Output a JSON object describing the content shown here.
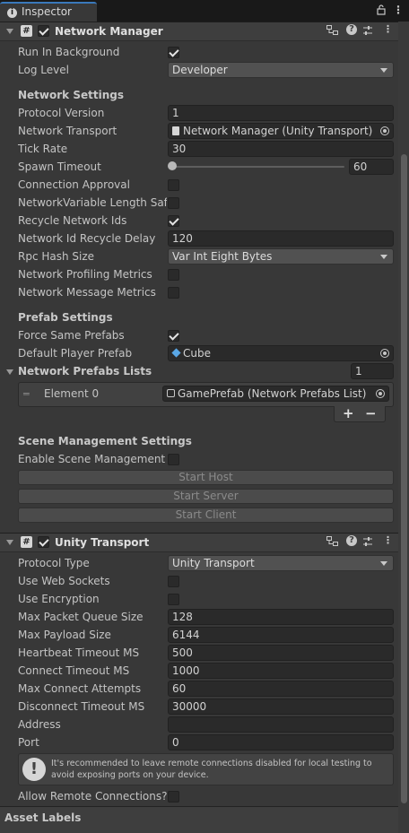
{
  "window": {
    "tab_label": "Inspector"
  },
  "network_manager": {
    "title": "Network Manager",
    "run_in_background": {
      "label": "Run In Background",
      "checked": true
    },
    "log_level": {
      "label": "Log Level",
      "value": "Developer"
    },
    "network_settings_header": "Network Settings",
    "protocol_version": {
      "label": "Protocol Version",
      "value": "1"
    },
    "network_transport": {
      "label": "Network Transport",
      "value": "Network Manager (Unity Transport)"
    },
    "tick_rate": {
      "label": "Tick Rate",
      "value": "30"
    },
    "spawn_timeout": {
      "label": "Spawn Timeout",
      "value": "60",
      "slider_fraction": 0.0
    },
    "connection_approval": {
      "label": "Connection Approval",
      "checked": false
    },
    "network_variable_length_safety": {
      "label": "NetworkVariable Length Safe",
      "checked": false
    },
    "recycle_network_ids": {
      "label": "Recycle Network Ids",
      "checked": true
    },
    "network_id_recycle_delay": {
      "label": "Network Id Recycle Delay",
      "value": "120"
    },
    "rpc_hash_size": {
      "label": "Rpc Hash Size",
      "value": "Var Int Eight Bytes"
    },
    "network_profiling_metrics": {
      "label": "Network Profiling Metrics",
      "checked": false
    },
    "network_message_metrics": {
      "label": "Network Message Metrics",
      "checked": false
    },
    "prefab_settings_header": "Prefab Settings",
    "force_same_prefabs": {
      "label": "Force Same Prefabs",
      "checked": true
    },
    "default_player_prefab": {
      "label": "Default Player Prefab",
      "value": "Cube"
    },
    "network_prefabs_lists": {
      "label": "Network Prefabs Lists",
      "count": "1",
      "elements": [
        {
          "label": "Element 0",
          "value": "GamePrefab (Network Prefabs List)"
        }
      ],
      "add_label": "+",
      "remove_label": "−"
    },
    "scene_management_header": "Scene Management Settings",
    "enable_scene_management": {
      "label": "Enable Scene Management",
      "checked": false
    },
    "buttons": {
      "start_host": "Start Host",
      "start_server": "Start Server",
      "start_client": "Start Client"
    }
  },
  "unity_transport": {
    "title": "Unity Transport",
    "protocol_type": {
      "label": "Protocol Type",
      "value": "Unity Transport"
    },
    "use_web_sockets": {
      "label": "Use Web Sockets",
      "checked": false
    },
    "use_encryption": {
      "label": "Use Encryption",
      "checked": false
    },
    "max_packet_queue_size": {
      "label": "Max Packet Queue Size",
      "value": "128"
    },
    "max_payload_size": {
      "label": "Max Payload Size",
      "value": "6144"
    },
    "heartbeat_timeout_ms": {
      "label": "Heartbeat Timeout MS",
      "value": "500"
    },
    "connect_timeout_ms": {
      "label": "Connect Timeout MS",
      "value": "1000"
    },
    "max_connect_attempts": {
      "label": "Max Connect Attempts",
      "value": "60"
    },
    "disconnect_timeout_ms": {
      "label": "Disconnect Timeout MS",
      "value": "30000"
    },
    "address": {
      "label": "Address",
      "value": ""
    },
    "port": {
      "label": "Port",
      "value": "0"
    },
    "help_box": {
      "line1": "It's recommended to leave remote connections disabled for local testing to",
      "line2": "avoid exposing ports on your device."
    },
    "allow_remote_connections": {
      "label": "Allow Remote Connections?",
      "checked": false
    }
  },
  "footer": {
    "asset_labels": "Asset Labels"
  },
  "colors": {
    "background": "#383838",
    "header": "#3e3e3e",
    "field": "#2a2a2a",
    "accent": "#3a79bb"
  }
}
